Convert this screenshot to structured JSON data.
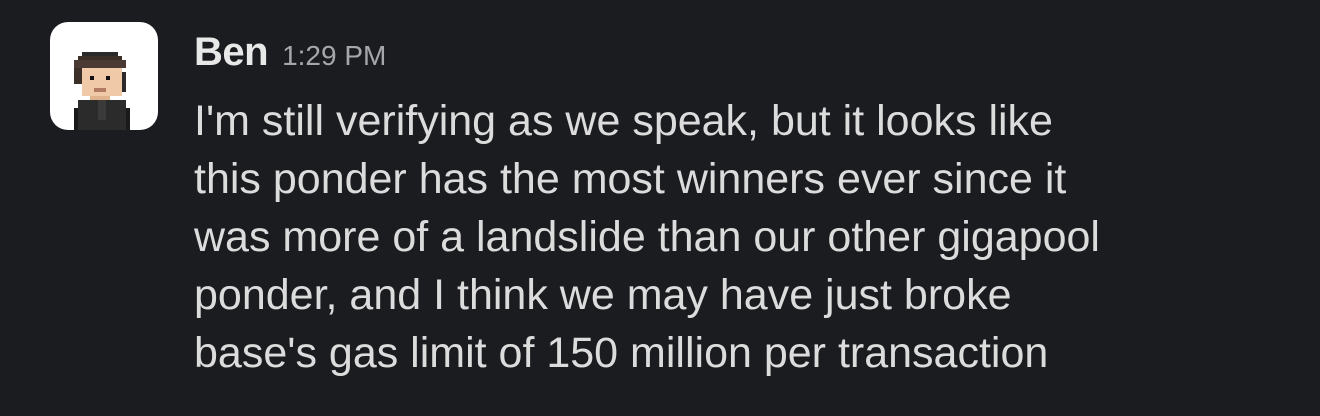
{
  "message": {
    "author": "Ben",
    "timestamp": "1:29 PM",
    "text": "I'm still verifying as we speak, but it looks like\nthis ponder has the most winners ever since it\nwas more of a landslide than our other gigapool\nponder, and I think we may have just broke\nbase's gas limit of 150 million per transaction",
    "avatar_icon": "pixel-art-person-icon"
  },
  "colors": {
    "background": "#1b1c20",
    "author": "#e8e8e8",
    "timestamp": "#a6a7ab",
    "text": "#dcdcdd",
    "avatar_bg": "#ffffff"
  }
}
